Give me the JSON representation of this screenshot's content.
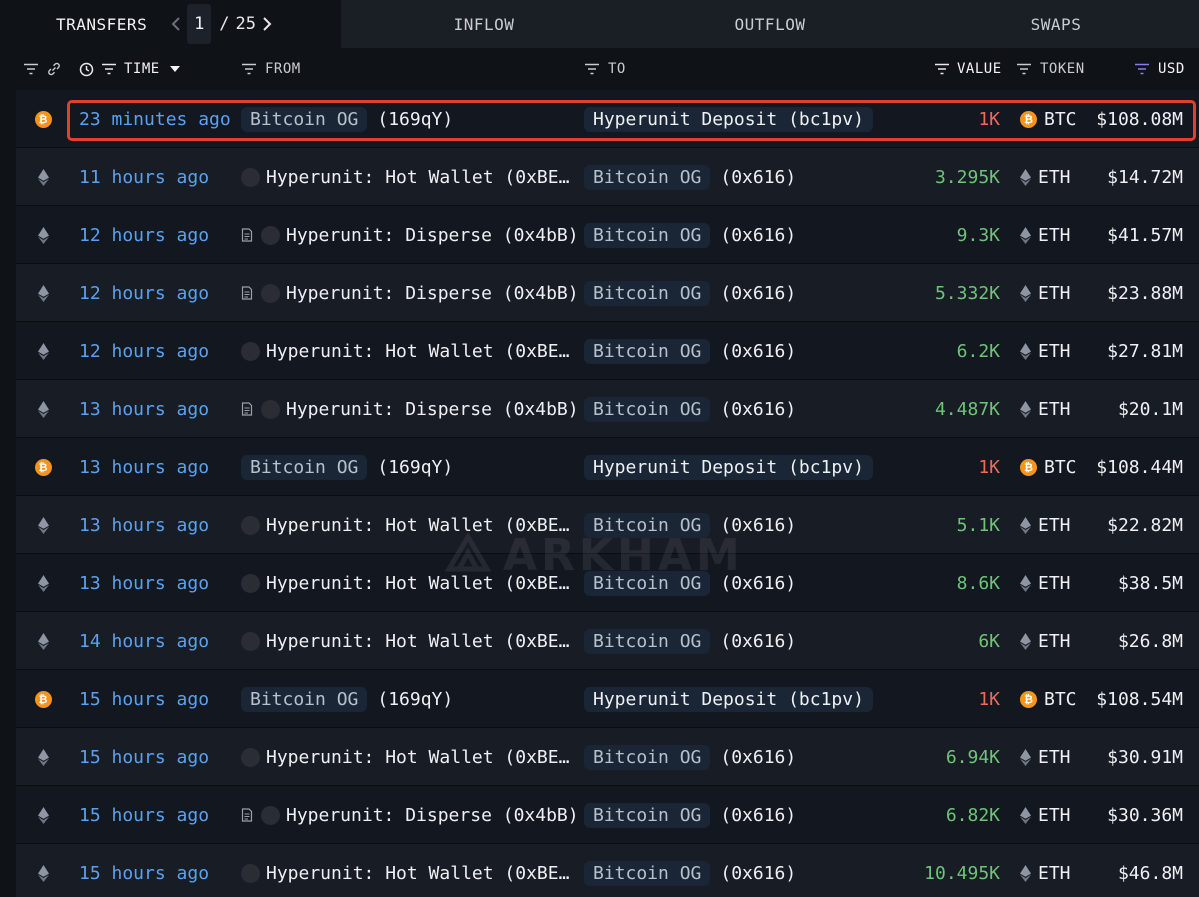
{
  "tabs": {
    "transfers": "TRANSFERS",
    "page_current": "1",
    "page_sep": "/",
    "page_total": "25",
    "inflow": "INFLOW",
    "outflow": "OUTFLOW",
    "swaps": "SWAPS"
  },
  "columns": {
    "time": "TIME",
    "from": "FROM",
    "to": "TO",
    "value": "VALUE",
    "token": "TOKEN",
    "usd": "USD"
  },
  "watermark": "ARKHAM",
  "colors": {
    "link_blue": "#5aa2f0",
    "inflow_green": "#6cc676",
    "outflow_red": "#ef6b59",
    "btc_orange": "#f7931a",
    "highlight_red": "#e2402d"
  },
  "rows": [
    {
      "chain": "btc",
      "time": "23 minutes ago",
      "from_icon": "none",
      "from_tag": "Bitcoin OG",
      "from_addr": "(169qY)",
      "to_tag": "",
      "to_name": "Hyperunit Deposit (bc1pv)",
      "value": "1K",
      "dir": "neg",
      "token": "BTC",
      "usd": "$108.08M"
    },
    {
      "chain": "eth",
      "time": "11 hours ago",
      "from_icon": "entity",
      "from_tag": "",
      "from_addr": "Hyperunit: Hot Wallet (0xBE…",
      "to_tag": "Bitcoin OG",
      "to_name": "(0x616)",
      "value": "3.295K",
      "dir": "pos",
      "token": "ETH",
      "usd": "$14.72M"
    },
    {
      "chain": "eth",
      "time": "12 hours ago",
      "from_icon": "contract",
      "from_tag": "",
      "from_addr": "Hyperunit: Disperse (0x4bB)",
      "to_tag": "Bitcoin OG",
      "to_name": "(0x616)",
      "value": "9.3K",
      "dir": "pos",
      "token": "ETH",
      "usd": "$41.57M"
    },
    {
      "chain": "eth",
      "time": "12 hours ago",
      "from_icon": "contract",
      "from_tag": "",
      "from_addr": "Hyperunit: Disperse (0x4bB)",
      "to_tag": "Bitcoin OG",
      "to_name": "(0x616)",
      "value": "5.332K",
      "dir": "pos",
      "token": "ETH",
      "usd": "$23.88M"
    },
    {
      "chain": "eth",
      "time": "12 hours ago",
      "from_icon": "entity",
      "from_tag": "",
      "from_addr": "Hyperunit: Hot Wallet (0xBE…",
      "to_tag": "Bitcoin OG",
      "to_name": "(0x616)",
      "value": "6.2K",
      "dir": "pos",
      "token": "ETH",
      "usd": "$27.81M"
    },
    {
      "chain": "eth",
      "time": "13 hours ago",
      "from_icon": "contract",
      "from_tag": "",
      "from_addr": "Hyperunit: Disperse (0x4bB)",
      "to_tag": "Bitcoin OG",
      "to_name": "(0x616)",
      "value": "4.487K",
      "dir": "pos",
      "token": "ETH",
      "usd": "$20.1M"
    },
    {
      "chain": "btc",
      "time": "13 hours ago",
      "from_icon": "none",
      "from_tag": "Bitcoin OG",
      "from_addr": "(169qY)",
      "to_tag": "",
      "to_name": "Hyperunit Deposit (bc1pv)",
      "value": "1K",
      "dir": "neg",
      "token": "BTC",
      "usd": "$108.44M"
    },
    {
      "chain": "eth",
      "time": "13 hours ago",
      "from_icon": "entity",
      "from_tag": "",
      "from_addr": "Hyperunit: Hot Wallet (0xBE…",
      "to_tag": "Bitcoin OG",
      "to_name": "(0x616)",
      "value": "5.1K",
      "dir": "pos",
      "token": "ETH",
      "usd": "$22.82M"
    },
    {
      "chain": "eth",
      "time": "13 hours ago",
      "from_icon": "entity",
      "from_tag": "",
      "from_addr": "Hyperunit: Hot Wallet (0xBE…",
      "to_tag": "Bitcoin OG",
      "to_name": "(0x616)",
      "value": "8.6K",
      "dir": "pos",
      "token": "ETH",
      "usd": "$38.5M"
    },
    {
      "chain": "eth",
      "time": "14 hours ago",
      "from_icon": "entity",
      "from_tag": "",
      "from_addr": "Hyperunit: Hot Wallet (0xBE…",
      "to_tag": "Bitcoin OG",
      "to_name": "(0x616)",
      "value": "6K",
      "dir": "pos",
      "token": "ETH",
      "usd": "$26.8M"
    },
    {
      "chain": "btc",
      "time": "15 hours ago",
      "from_icon": "none",
      "from_tag": "Bitcoin OG",
      "from_addr": "(169qY)",
      "to_tag": "",
      "to_name": "Hyperunit Deposit (bc1pv)",
      "value": "1K",
      "dir": "neg",
      "token": "BTC",
      "usd": "$108.54M"
    },
    {
      "chain": "eth",
      "time": "15 hours ago",
      "from_icon": "entity",
      "from_tag": "",
      "from_addr": "Hyperunit: Hot Wallet (0xBE…",
      "to_tag": "Bitcoin OG",
      "to_name": "(0x616)",
      "value": "6.94K",
      "dir": "pos",
      "token": "ETH",
      "usd": "$30.91M"
    },
    {
      "chain": "eth",
      "time": "15 hours ago",
      "from_icon": "contract",
      "from_tag": "",
      "from_addr": "Hyperunit: Disperse (0x4bB)",
      "to_tag": "Bitcoin OG",
      "to_name": "(0x616)",
      "value": "6.82K",
      "dir": "pos",
      "token": "ETH",
      "usd": "$30.36M"
    },
    {
      "chain": "eth",
      "time": "15 hours ago",
      "from_icon": "entity",
      "from_tag": "",
      "from_addr": "Hyperunit: Hot Wallet (0xBE…",
      "to_tag": "Bitcoin OG",
      "to_name": "(0x616)",
      "value": "10.495K",
      "dir": "pos",
      "token": "ETH",
      "usd": "$46.8M"
    }
  ]
}
